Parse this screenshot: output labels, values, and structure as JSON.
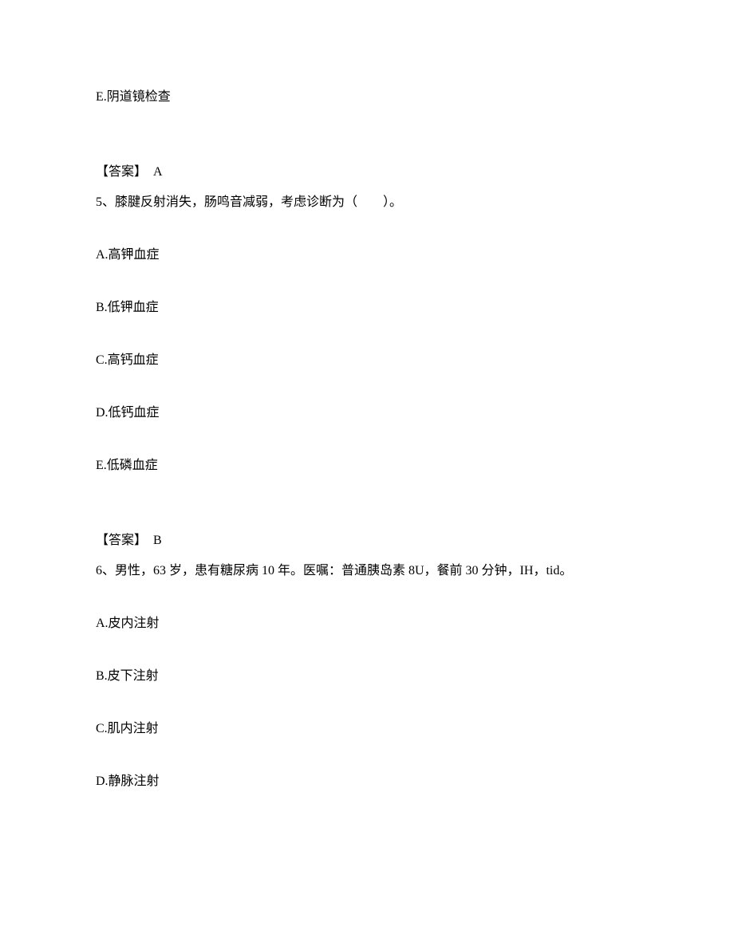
{
  "q4_optE": "E.阴道镜检查",
  "answer4_label": "【答案】",
  "answer4_value": "A",
  "q5_text": "5、膝腱反射消失，肠鸣音减弱，考虑诊断为（　　）。",
  "q5_optA": "A.高钾血症",
  "q5_optB": "B.低钾血症",
  "q5_optC": "C.高钙血症",
  "q5_optD": "D.低钙血症",
  "q5_optE": "E.低磷血症",
  "answer5_label": "【答案】",
  "answer5_value": "B",
  "q6_text": "6、男性，63 岁，患有糖尿病 10 年。医嘱：普通胰岛素 8U，餐前 30 分钟，IH，tid。",
  "q6_optA": "A.皮内注射",
  "q6_optB": "B.皮下注射",
  "q6_optC": "C.肌内注射",
  "q6_optD": "D.静脉注射"
}
